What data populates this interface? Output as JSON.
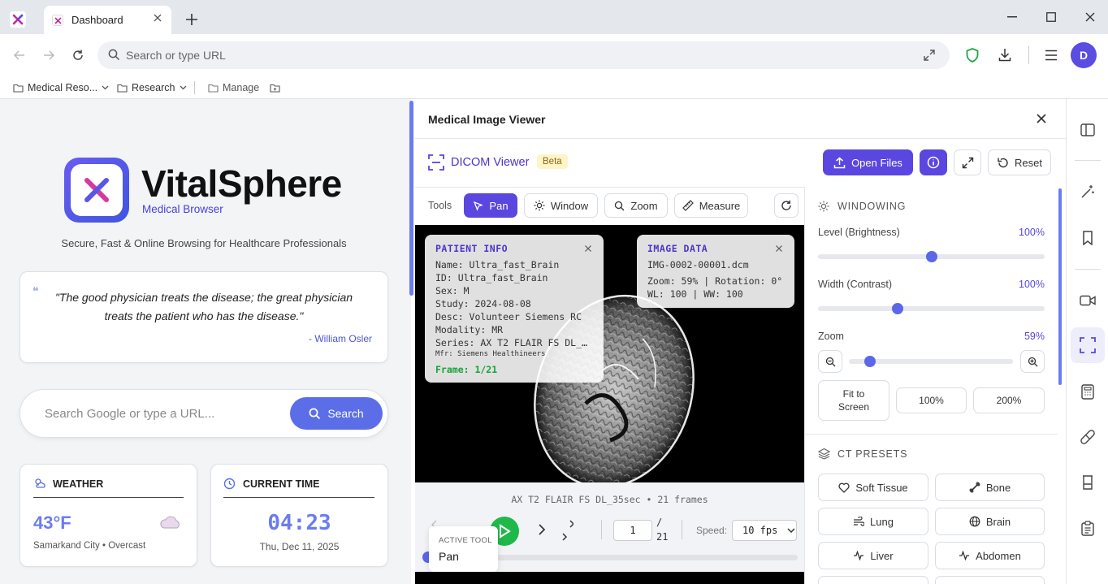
{
  "browser": {
    "tab_title": "Dashboard",
    "url_placeholder": "Search or type URL",
    "avatar_letter": "D",
    "bookmarks": [
      {
        "label": "Medical Reso..."
      },
      {
        "label": "Research"
      },
      {
        "label": "Manage"
      }
    ]
  },
  "homepage": {
    "brand_name": "VitalSphere",
    "brand_sub": "Medical Browser",
    "tagline": "Secure, Fast & Online Browsing for Healthcare Professionals",
    "quote_mark": "❝",
    "quote_line1": "\"The good physician treats the disease; the great physician",
    "quote_line2": "treats the patient who has the disease.\"",
    "quote_author": "- William Osler",
    "search_placeholder": "Search Google or type a URL...",
    "search_button": "Search",
    "weather": {
      "title": "WEATHER",
      "temp": "43°F",
      "location": "Samarkand City • Overcast"
    },
    "time": {
      "title": "CURRENT TIME",
      "clock": "04:23",
      "date": "Thu, Dec 11, 2025"
    }
  },
  "viewer": {
    "panel_title": "Medical Image Viewer",
    "dicom_label": "DICOM Viewer",
    "beta_badge": "Beta",
    "open_files": "Open Files",
    "reset": "Reset",
    "tools_label": "Tools",
    "tools": [
      "Pan",
      "Window",
      "Zoom",
      "Measure"
    ],
    "active_tool_index": 0,
    "patient_info": {
      "title": "PATIENT INFO",
      "name": "Name: Ultra_fast_Brain",
      "id": "ID: Ultra_fast_Brain",
      "sex": "Sex: M",
      "study": "Study: 2024-08-08",
      "desc": "Desc: Volunteer Siemens RC",
      "modality": "Modality: MR",
      "series": "Series: AX T2 FLAIR FS DL_…",
      "mfr": "Mfr: Siemens Healthineers",
      "frame": "Frame: 1/21"
    },
    "image_data": {
      "title": "IMAGE DATA",
      "file": "IMG-0002-00001.dcm",
      "zoom_rot": "Zoom: 59% | Rotation: 0°",
      "wl_ww": "WL: 100 | WW: 100"
    },
    "series_caption": "AX T2 FLAIR FS DL_35sec • 21 frames",
    "frame_value": "1",
    "frame_total": "/ 21",
    "speed_label": "Speed:",
    "speed_value": "10 fps",
    "active_tool_caption": "ACTIVE TOOL",
    "active_tool_name": "Pan"
  },
  "windowing": {
    "title": "WINDOWING",
    "level_label": "Level (Brightness)",
    "level_value": "100%",
    "level_fraction": 0.5,
    "width_label": "Width (Contrast)",
    "width_value": "100%",
    "width_fraction": 0.35,
    "zoom_label": "Zoom",
    "zoom_value": "59%",
    "zoom_fraction": 0.13,
    "fit_line1": "Fit to",
    "fit_line2": "Screen",
    "zoom_100": "100%",
    "zoom_200": "200%"
  },
  "presets": {
    "title": "CT PRESETS",
    "items": [
      "Soft Tissue",
      "Bone",
      "Lung",
      "Brain",
      "Liver",
      "Abdomen"
    ]
  },
  "colors": {
    "accent": "#5a47e0",
    "play": "#1fb84a",
    "shield": "#22a34a",
    "frame_green": "#15a33a"
  }
}
